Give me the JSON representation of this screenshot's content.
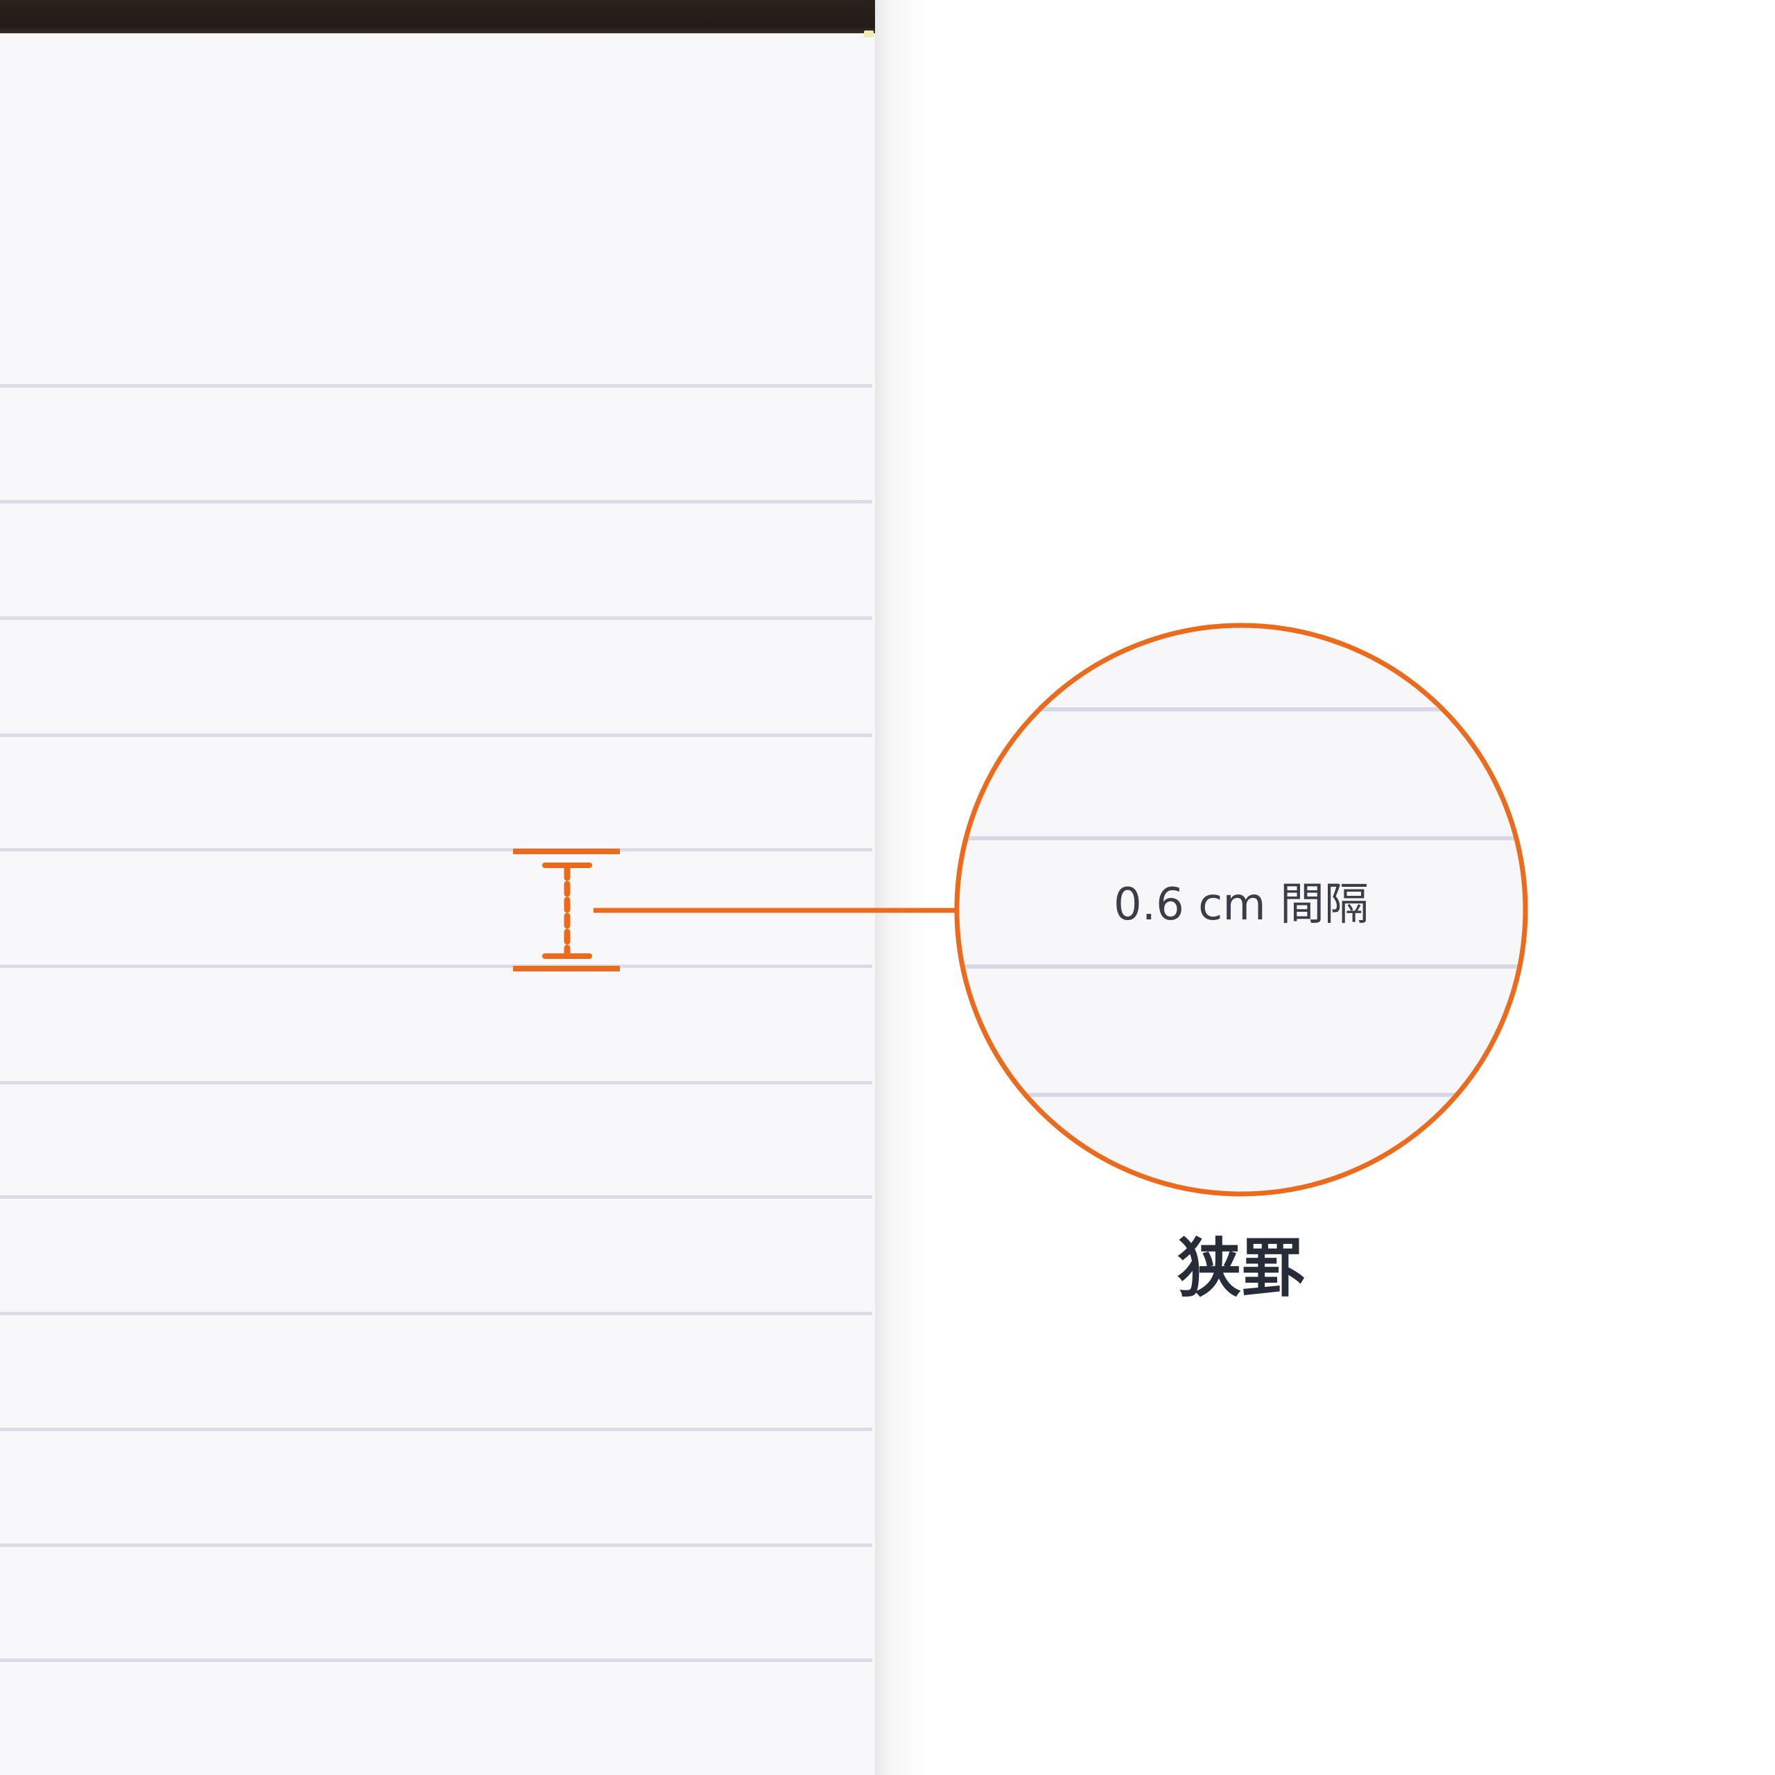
{
  "zoom_callout": {
    "spacing_label": "0.6 cm 間隔",
    "accent_color": "#ec6a1c"
  },
  "caption": "狭罫",
  "paper": {
    "binding_color": "#231b17",
    "rule_color": "#dcdbe7",
    "sheet_color": "#f8f7fa"
  }
}
